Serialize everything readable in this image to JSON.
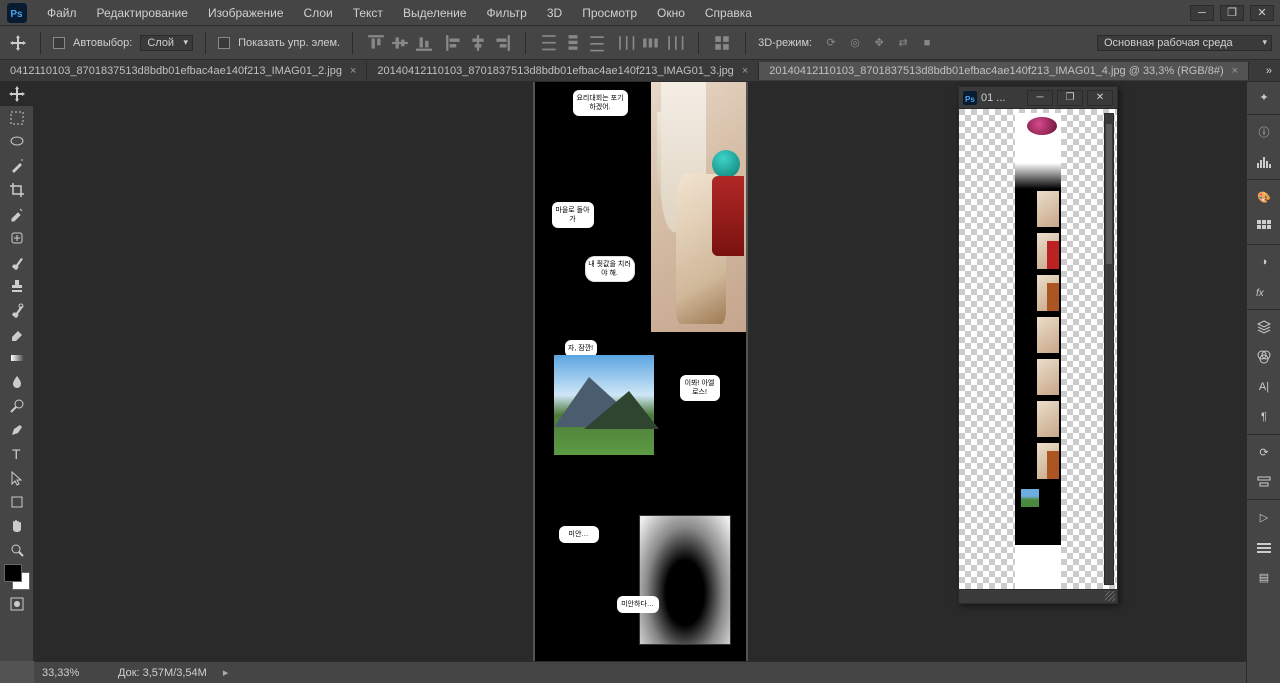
{
  "menu": {
    "items": [
      "Файл",
      "Редактирование",
      "Изображение",
      "Слои",
      "Текст",
      "Выделение",
      "Фильтр",
      "3D",
      "Просмотр",
      "Окно",
      "Справка"
    ]
  },
  "options": {
    "autoselect_label": "Автовыбор:",
    "autoselect_value": "Слой",
    "show_transform_label": "Показать упр. элем.",
    "mode_3d_label": "3D-режим:",
    "workspace_label": "Основная рабочая среда"
  },
  "tabs": [
    {
      "label": "0412110103_8701837513d8bdb01efbac4ae140f213_IMAG01_2.jpg",
      "active": false
    },
    {
      "label": "20140412110103_8701837513d8bdb01efbac4ae140f213_IMAG01_3.jpg",
      "active": false
    },
    {
      "label": "20140412110103_8701837513d8bdb01efbac4ae140f213_IMAG01_4.jpg @ 33,3% (RGB/8#)",
      "active": true
    }
  ],
  "canvas": {
    "bubbles": {
      "b1": "요리대회는 포기하겠어.",
      "b2": "마을로 돌아가",
      "b3": "내 죗값을 치러야 해.",
      "b4": "자, 잠깐!",
      "b5": "이봐! 아엘로스!",
      "b6": "미안…",
      "b7": "미안하다…"
    }
  },
  "navigator": {
    "title": "01 ..."
  },
  "status": {
    "zoom": "33,33%",
    "doc": "Док: 3,57M/3,54M"
  }
}
